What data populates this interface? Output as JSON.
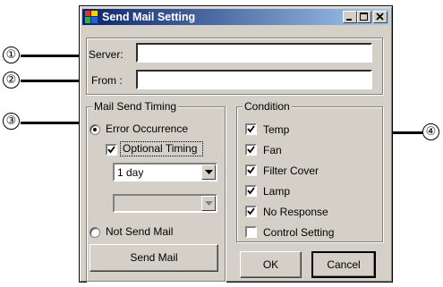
{
  "window": {
    "title": "Send Mail Setting",
    "app_icon": "mail-app-icon",
    "controls": [
      "minimize-icon",
      "maximize-icon",
      "close-icon"
    ]
  },
  "server": {
    "label": "Server:",
    "value": ""
  },
  "from": {
    "label": "From :",
    "value": ""
  },
  "mail_send_timing": {
    "title": "Mail Send Timing",
    "error_occurrence": {
      "label": "Error Occurrence",
      "selected": true
    },
    "optional_timing": {
      "label": "Optional Timing",
      "checked": true
    },
    "interval_select": {
      "value": "1 day"
    },
    "secondary_select": {
      "value": "",
      "enabled": false
    },
    "not_send_mail": {
      "label": "Not Send Mail",
      "selected": false
    },
    "send_mail_button": "Send Mail"
  },
  "condition": {
    "title": "Condition",
    "items": [
      {
        "label": "Temp",
        "checked": true
      },
      {
        "label": "Fan",
        "checked": true
      },
      {
        "label": "Filter Cover",
        "checked": true
      },
      {
        "label": "Lamp",
        "checked": true
      },
      {
        "label": "No Response",
        "checked": true
      },
      {
        "label": "Control Setting",
        "checked": false
      }
    ]
  },
  "ok_button": "OK",
  "cancel_button": "Cancel",
  "callouts": [
    "①",
    "②",
    "③",
    "④"
  ],
  "colors": {
    "titlebar_start": "#0a246a",
    "titlebar_end": "#a6caf0",
    "face": "#d4d0c8"
  }
}
